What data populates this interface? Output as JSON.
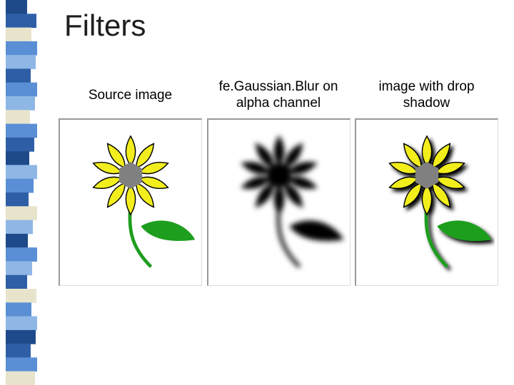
{
  "title": "Filters",
  "columns": [
    {
      "label": "Source image"
    },
    {
      "label": "fe.Gaussian.Blur on\nalpha channel"
    },
    {
      "label": "image with drop\nshadow"
    }
  ],
  "sidebar_colors": [
    "#1f4a8a",
    "#2e5fa6",
    "#e8e4cc",
    "#5a8fd6",
    "#8fb7e6",
    "#2e5fa6",
    "#5a8fd6",
    "#8fb7e6",
    "#e8e4cc",
    "#5a8fd6",
    "#2e5fa6",
    "#1f4a8a",
    "#8fb7e6",
    "#5a8fd6",
    "#2e5fa6",
    "#e8e4cc",
    "#8fb7e6",
    "#1f4a8a",
    "#5a8fd6",
    "#8fb7e6",
    "#2e5fa6",
    "#e8e4cc",
    "#5a8fd6",
    "#8fb7e6",
    "#1f4a8a",
    "#2e5fa6",
    "#5a8fd6",
    "#e8e4cc"
  ],
  "flower": {
    "petal_fill": "#f2ee1e",
    "petal_stroke": "#000000",
    "center_fill": "#808080",
    "leaf_fill": "#1e9e1e",
    "stem_stroke": "#1e9e1e"
  }
}
